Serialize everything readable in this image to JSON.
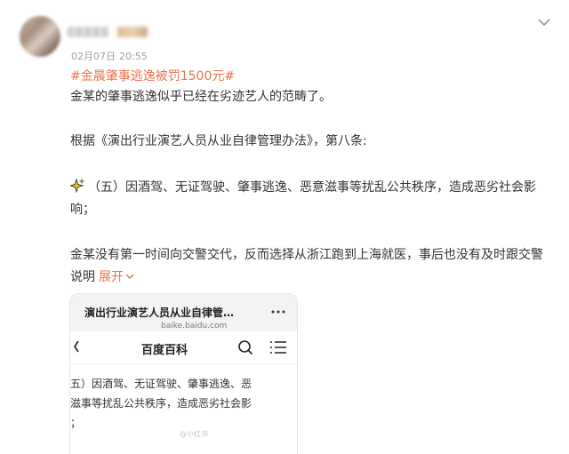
{
  "post": {
    "date": "02月07日",
    "time": "20:55",
    "hashtag": "#金晨肇事逃逸被罚1500元#",
    "paragraphs": {
      "p1": "金某的肇事逃逸似乎已经在劣迹艺人的范畴了。",
      "p2": "根据《演出行业演艺人员从业自律管理办法》，第八条:",
      "p3_line1": "（五）因酒驾、无证驾驶、肇事逃逸、恶意滋事等扰乱公共秩序，造成恶劣社会影",
      "p3_line2": "响；",
      "p4_line1": "金某没有第一时间向交警交代，反而选择从浙江跑到上海就医，事后也没有及时跟交警",
      "p4_line2": "说明"
    },
    "expand_label": "展开",
    "accent_color": "#eb7350"
  },
  "link_card": {
    "title": "演出行业演艺人员从业自律管…",
    "url": "baike.baidu.com",
    "menu_icon": "more-dots-icon"
  },
  "baike": {
    "title": "百度百科",
    "search_icon": "search-icon",
    "menu_icon": "menu-icon",
    "back_icon": "back-icon",
    "excerpt_line1": "五）因酒驾、无证驾驶、肇事逃逸、恶",
    "excerpt_line2": "滋事等扰乱公共秩序，造成恶劣社会影",
    "excerpt_line3": "；"
  },
  "watermark": "@小红书"
}
